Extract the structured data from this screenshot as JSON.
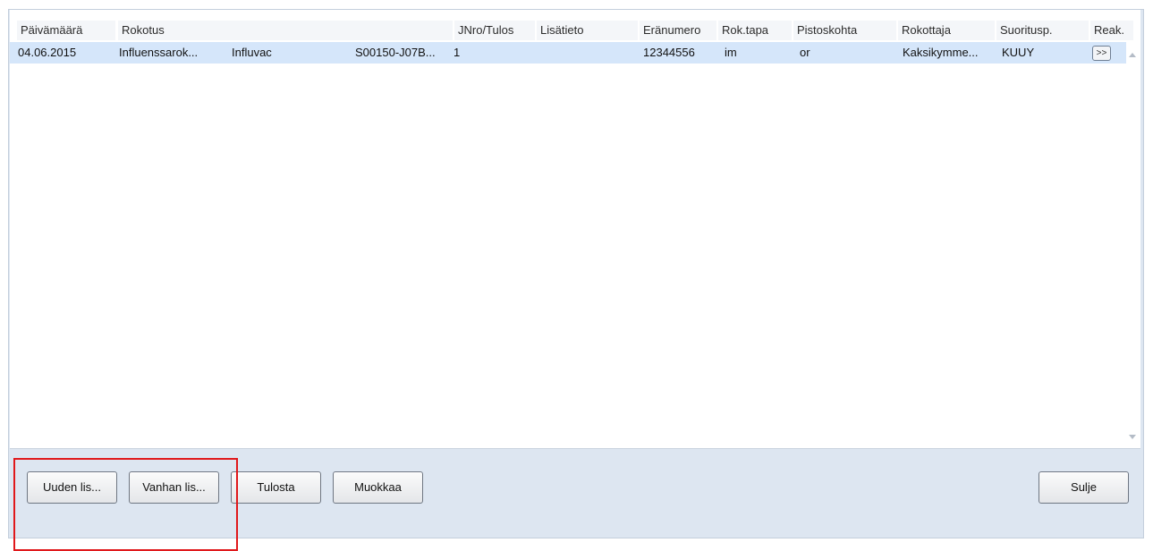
{
  "table": {
    "columns": [
      "Päivämäärä",
      "Rokotus",
      "JNro/Tulos",
      "Lisätieto",
      "Eränumero",
      "Rok.tapa",
      "Pistoskohta",
      "Rokottaja",
      "Suoritusp.",
      "Reak."
    ],
    "rows": [
      {
        "date": "04.06.2015",
        "vaccination": "Influenssarok...",
        "product": "Influvac",
        "code": "S00150-J07B...",
        "jnro": "1",
        "info": "",
        "batch": "12344556",
        "method": "im",
        "site": "or",
        "vaccinator": "Kaksikymme...",
        "place": "KUUY",
        "reaction_button": ">>"
      }
    ]
  },
  "buttons": {
    "new_entry": "Uuden lis...",
    "old_entry": "Vanhan lis...",
    "print": "Tulosta",
    "edit": "Muokkaa",
    "close": "Sulje"
  },
  "colors": {
    "selected_row": "#d5e6fa",
    "panel_background": "#dde6f1",
    "highlight_box": "#e0181b"
  },
  "icons": [
    "scroll-up-arrow-icon",
    "scroll-down-arrow-icon"
  ]
}
